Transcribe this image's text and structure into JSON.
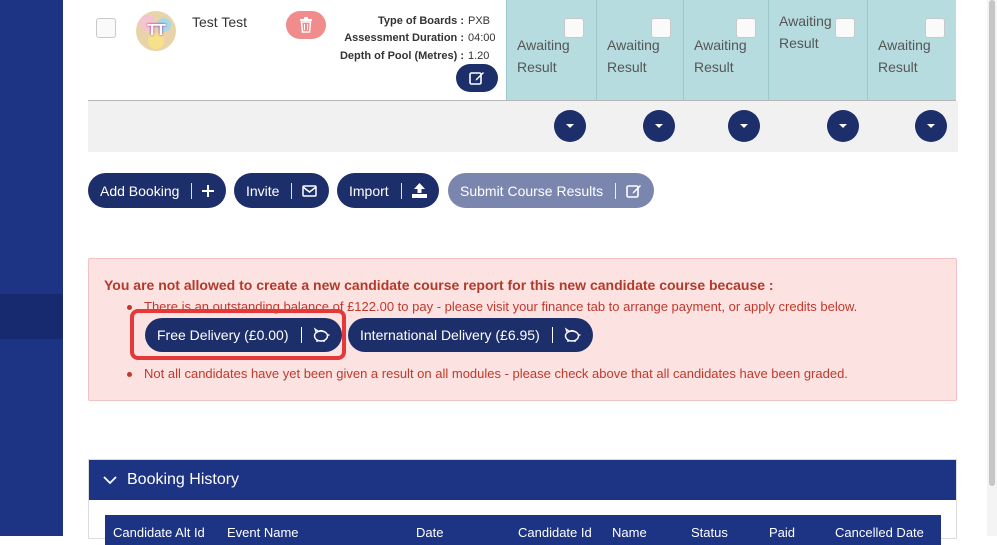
{
  "candidate": {
    "name": "Test Test",
    "avatar_initials": "TT",
    "info": [
      {
        "label": "Type of Boards :",
        "value": "PXB"
      },
      {
        "label": "Assessment Duration :",
        "value": "04:00"
      },
      {
        "label": "Depth of Pool (Metres) :",
        "value": "1.20"
      }
    ],
    "results": [
      "Awaiting Result",
      "Awaiting Result",
      "Awaiting Result",
      "Awaiting Result",
      "Awaiting Result"
    ]
  },
  "actions": {
    "add_booking": "Add Booking",
    "invite": "Invite",
    "import": "Import",
    "submit_course_results": "Submit Course Results"
  },
  "alert": {
    "title": "You are not allowed to create a new candidate course report for this new candidate course because :",
    "reason_balance": "There is an outstanding balance of £122.00 to pay - please visit your finance tab to arrange payment, or apply credits below.",
    "reason_results": "Not all candidates have yet been given a result on all modules - please check above that all candidates have been graded.",
    "free_delivery": "Free Delivery (£0.00)",
    "international_delivery": "International Delivery (£6.95)"
  },
  "booking_history": {
    "title": "Booking History",
    "columns": [
      "Candidate Alt Id",
      "Event Name",
      "Date",
      "Candidate Id",
      "Name",
      "Status",
      "Paid",
      "Cancelled Date"
    ]
  },
  "colors": {
    "navy": "#1d2f6b",
    "sidebar": "#1d3383",
    "result_bg": "#b6dcdf",
    "alert_bg": "#fde2e2",
    "alert_text": "#c0392b",
    "highlight": "#e53939",
    "danger_btn": "#f08c8c"
  },
  "icons": [
    "trash-icon",
    "edit-icon",
    "chevron-down-icon",
    "plus-icon",
    "envelope-icon",
    "upload-icon",
    "piggy-bank-icon"
  ]
}
